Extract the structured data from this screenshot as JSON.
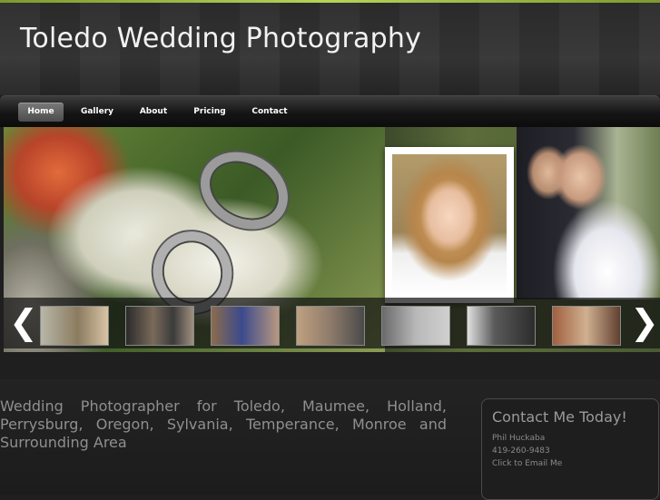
{
  "site": {
    "title": "Toledo Wedding Photography"
  },
  "nav": {
    "items": [
      {
        "label": "Home",
        "active": true
      },
      {
        "label": "Gallery",
        "active": false
      },
      {
        "label": "About",
        "active": false
      },
      {
        "label": "Pricing",
        "active": false
      },
      {
        "label": "Contact",
        "active": false
      }
    ]
  },
  "slideshow": {
    "prev_icon": "chevron-left-icon",
    "next_icon": "chevron-right-icon",
    "prev_glyph": "❮",
    "next_glyph": "❯",
    "thumbnail_count": 7
  },
  "main": {
    "tagline": "Wedding Photographer for Toledo, Maumee, Holland, Perrysburg, Oregon, Sylvania, Temperance, Monroe and Surrounding Area"
  },
  "contact": {
    "title": "Contact Me Today!",
    "name": "Phil Huckaba",
    "phone": "419-260-9483",
    "email_link": "Click to Email Me"
  },
  "colors": {
    "accent": "#9cbc3f",
    "background": "#1f1f1f",
    "text_muted": "#8f8f8f"
  }
}
